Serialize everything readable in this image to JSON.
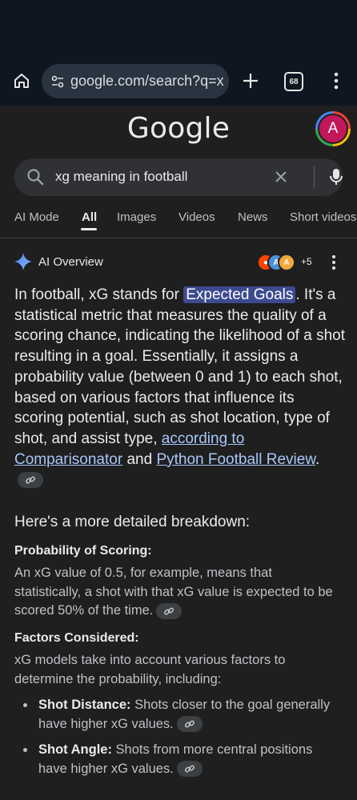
{
  "browser": {
    "url": "google.com/search?q=x",
    "tab_count": "68"
  },
  "search": {
    "logo": "Google",
    "query": "xg meaning in football",
    "avatar_letter": "A"
  },
  "tabs": [
    {
      "label": "AI Mode"
    },
    {
      "label": "All"
    },
    {
      "label": "Images"
    },
    {
      "label": "Videos"
    },
    {
      "label": "News"
    },
    {
      "label": "Short videos"
    }
  ],
  "ai_overview": {
    "title": "AI Overview",
    "more_sources": "+5",
    "intro_before": "In football, xG stands for ",
    "intro_highlight": "Expected Goals",
    "intro_after": ". It's a statistical metric that measures the quality of a scoring chance, indicating the likelihood of a shot resulting in a goal. Essentially, it assigns a probability value (between 0 and 1) to each shot, based on various factors that influence its scoring potential, such as shot location, type of shot, and assist type, ",
    "link1": "according to Comparisonator",
    "and_text": " and ",
    "link2": "Python Football Review",
    "end_text": ".",
    "breakdown_title": "Here's a more detailed breakdown:",
    "sections": [
      {
        "heading": "Probability of Scoring:",
        "body": "An xG value of 0.5, for example, means that statistically, a shot with that xG value is expected to be scored 50% of the time."
      },
      {
        "heading": "Factors Considered:",
        "body": "xG models take into account various factors to determine the probability, including:"
      }
    ],
    "bullets": [
      {
        "term": "Shot Distance:",
        "text": " Shots closer to the goal generally have higher xG values."
      },
      {
        "term": "Shot Angle:",
        "text": " Shots from more central positions have higher xG values."
      }
    ]
  }
}
